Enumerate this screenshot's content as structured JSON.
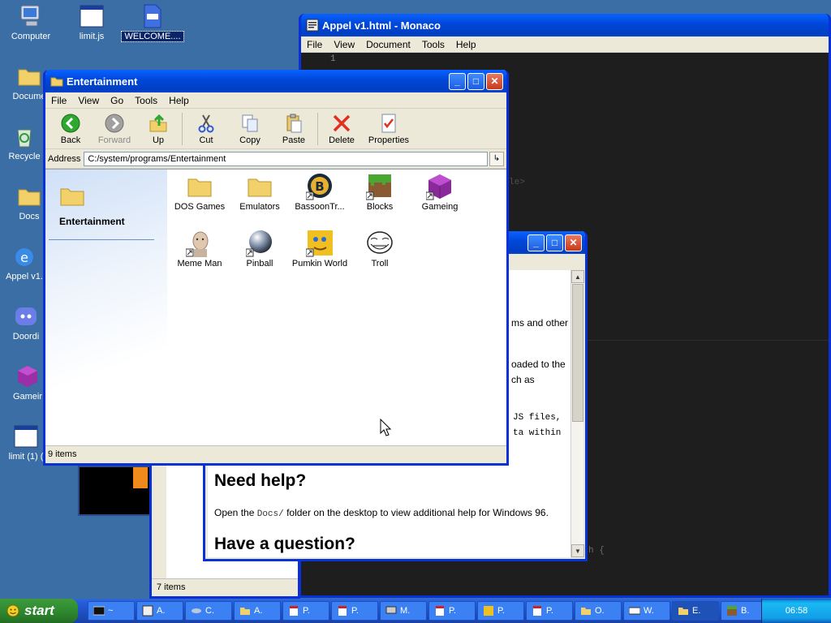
{
  "desktop": {
    "icons": [
      {
        "label": "Computer"
      },
      {
        "label": "limit.js"
      },
      {
        "label": "WELCOME...."
      },
      {
        "label": "Docume"
      },
      {
        "label": "Recycle"
      },
      {
        "label": "Docs"
      },
      {
        "label": "Appel v1."
      },
      {
        "label": "Doordi"
      },
      {
        "label": "Gameir"
      },
      {
        "label": "limit (1) ("
      }
    ]
  },
  "monaco": {
    "title": "Appel v1.html - Monaco",
    "menu": [
      "File",
      "View",
      "Document",
      "Tools",
      "Help"
    ],
    "line_number": "1",
    "fragments": [
      "le>",
      "h {"
    ]
  },
  "readme": {
    "frag1": "ms and other",
    "frag2": "oaded to the",
    "frag3": "ch as",
    "frag4": "JS files,",
    "frag5": "ta within",
    "help_heading": "Need help?",
    "help_text_pre": "Open the ",
    "help_code": "Docs/",
    "help_text_post": " folder on the desktop to view additional help for Windows 96.",
    "question_heading": "Have a question?"
  },
  "back_panel": {
    "status": "7 items"
  },
  "explorer": {
    "title": "Entertainment",
    "menu": [
      "File",
      "View",
      "Go",
      "Tools",
      "Help"
    ],
    "toolbar": {
      "back": "Back",
      "forward": "Forward",
      "up": "Up",
      "cut": "Cut",
      "copy": "Copy",
      "paste": "Paste",
      "delete": "Delete",
      "properties": "Properties"
    },
    "address_label": "Address",
    "address_value": "C:/system/programs/Entertainment",
    "sidebar_title": "Entertainment",
    "items": [
      {
        "label": "DOS Games",
        "icon": "folder-icon"
      },
      {
        "label": "Emulators",
        "icon": "folder-icon"
      },
      {
        "label": "BassoonTr...",
        "icon": "bassoon-icon"
      },
      {
        "label": "Blocks",
        "icon": "grass-block-icon"
      },
      {
        "label": "Gameing",
        "icon": "purple-cube-icon"
      },
      {
        "label": "Meme Man",
        "icon": "meme-man-icon"
      },
      {
        "label": "Pinball",
        "icon": "pinball-icon"
      },
      {
        "label": "Pumkin World",
        "icon": "pumpkin-face-icon"
      },
      {
        "label": "Troll",
        "icon": "troll-face-icon"
      }
    ],
    "status": "9 items"
  },
  "taskbar": {
    "start_label": "start",
    "tasks": [
      {
        "label": "~"
      },
      {
        "label": "A."
      },
      {
        "label": "C."
      },
      {
        "label": "A."
      },
      {
        "label": "P."
      },
      {
        "label": "P."
      },
      {
        "label": "M."
      },
      {
        "label": "P."
      },
      {
        "label": "P."
      },
      {
        "label": "P."
      },
      {
        "label": "O."
      },
      {
        "label": "W."
      },
      {
        "label": "E."
      },
      {
        "label": "B."
      }
    ],
    "clock": "06:58"
  }
}
